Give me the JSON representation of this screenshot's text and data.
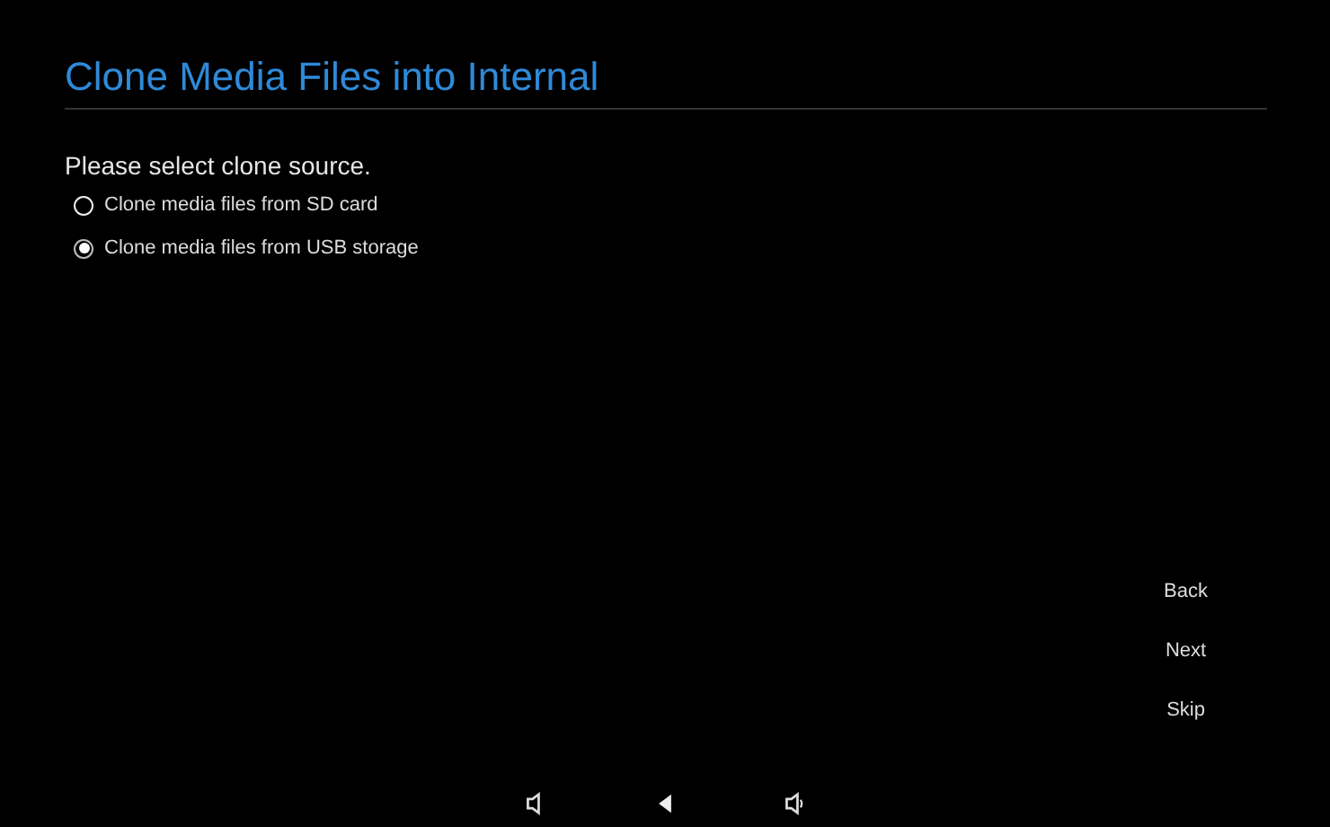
{
  "title": "Clone Media Files into Internal",
  "prompt": "Please select clone source.",
  "options": [
    {
      "label": "Clone media files from SD card",
      "selected": false
    },
    {
      "label": "Clone media files from USB storage",
      "selected": true
    }
  ],
  "buttons": [
    "Back",
    "Next",
    "Skip"
  ],
  "nav_bar": [
    {
      "kind": "volume-down"
    },
    {
      "kind": "back"
    },
    {
      "kind": "volume-up"
    }
  ]
}
